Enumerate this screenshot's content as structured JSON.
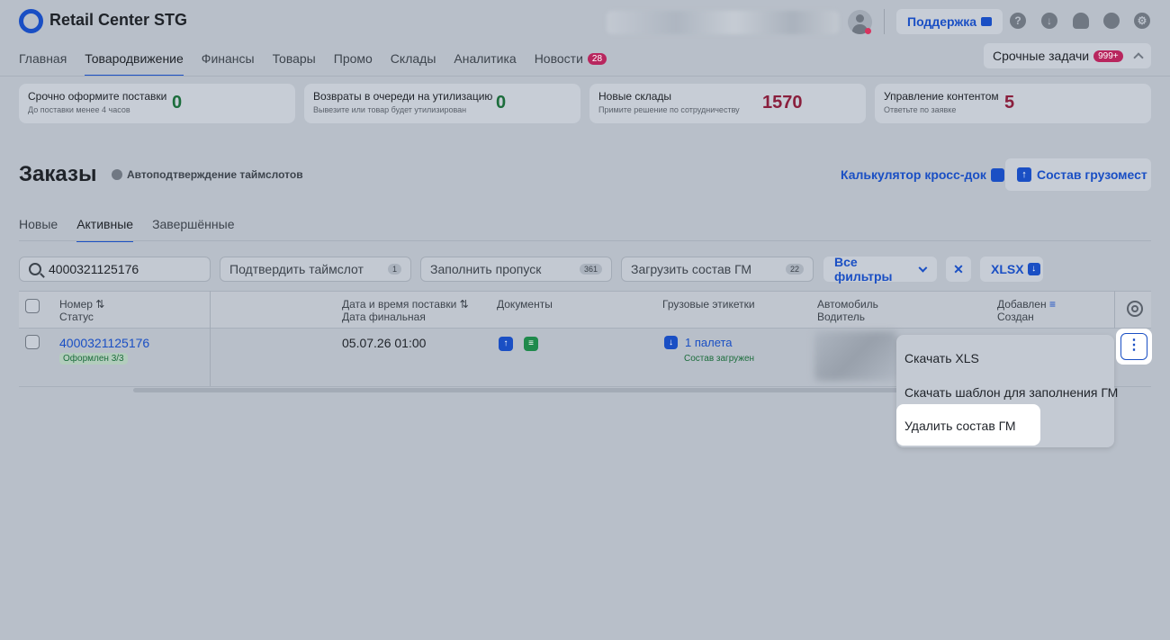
{
  "app": {
    "title": "Retail Center STG"
  },
  "header": {
    "support_label": "Поддержка"
  },
  "nav": {
    "items": [
      "Главная",
      "Товародвижение",
      "Финансы",
      "Товары",
      "Промо",
      "Склады",
      "Аналитика",
      "Новости"
    ],
    "active_index": 1,
    "news_badge": "28"
  },
  "urgent": {
    "label": "Срочные задачи",
    "badge": "999+"
  },
  "cards": [
    {
      "title": "Срочно оформите поставки",
      "subtitle": "До поставки менее 4 часов",
      "value": "0",
      "color": "#1c6d3c"
    },
    {
      "title": "Возвраты в очереди на утилизацию",
      "subtitle": "Вывезите или товар будет утилизирован",
      "value": "0",
      "color": "#1c6d3c"
    },
    {
      "title": "Новые склады",
      "subtitle": "Примите решение по сотрудничеству",
      "value": "1570",
      "color": "#8a1f3d"
    },
    {
      "title": "Управление контентом",
      "subtitle": "Ответьте по заявке",
      "value": "5",
      "color": "#8a1f3d"
    }
  ],
  "page": {
    "title": "Заказы",
    "auto_confirm": "Автоподтверждение таймслотов",
    "calc_link": "Калькулятор кросс-док",
    "cargo_button": "Состав грузомест"
  },
  "subtabs": {
    "items": [
      "Новые",
      "Активные",
      "Завершённые"
    ],
    "active_index": 1
  },
  "filters": {
    "search_value": "4000321125176",
    "confirm": {
      "label": "Подтвердить таймслот",
      "count": "1"
    },
    "pass": {
      "label": "Заполнить пропуск",
      "count": "361"
    },
    "upload": {
      "label": "Загрузить состав ГМ",
      "count": "22"
    },
    "all_filters": "Все фильтры",
    "clear": "✕",
    "xlsx": "XLSX"
  },
  "table": {
    "headers": {
      "number": "Номер",
      "status": "Статус",
      "date": "Дата и время поставки",
      "date_final": "Дата финальная",
      "documents": "Документы",
      "labels": "Грузовые этикетки",
      "car": "Автомобиль",
      "driver": "Водитель",
      "added": "Добавлен",
      "created": "Создан"
    },
    "rows": [
      {
        "number": "4000321125176",
        "status": "Оформлен 3/3",
        "date": "05.07.26 01:00",
        "pallets": "1 палета",
        "labels_status": "Состав загружен"
      }
    ]
  },
  "menu": {
    "items": [
      "Скачать XLS",
      "Скачать шаблон для заполнения ГМ",
      "Удалить состав ГМ"
    ]
  },
  "colors": {
    "accent": "#1a4fc4",
    "background": "#b8bfc9",
    "positive": "#1c6d3c",
    "danger": "#8a1f3d"
  }
}
